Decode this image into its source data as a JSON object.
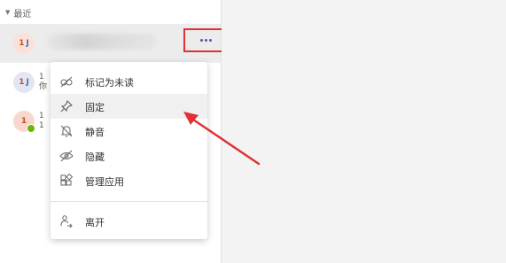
{
  "sidebar": {
    "section_title": "最近",
    "chats": [
      {
        "avatar_left": "1",
        "avatar_right": "J",
        "frag1": "",
        "frag2": "",
        "avatar_bg": "#fbe1d9"
      },
      {
        "avatar_left": "1",
        "avatar_right": "J",
        "frag1": "1",
        "frag2": "你",
        "avatar_bg": "#e2e6f3"
      },
      {
        "avatar_left": "1",
        "avatar_right": "",
        "frag1": "1",
        "frag2": "1",
        "avatar_bg": "#f7d8cd"
      }
    ]
  },
  "context_menu": {
    "items": [
      {
        "label": "标记为未读",
        "icon": "eye-mark-unread-icon"
      },
      {
        "label": "固定",
        "icon": "pin-icon"
      },
      {
        "label": "静音",
        "icon": "bell-off-icon"
      },
      {
        "label": "隐藏",
        "icon": "eye-off-icon"
      },
      {
        "label": "管理应用",
        "icon": "apps-icon"
      },
      {
        "label": "离开",
        "icon": "leave-icon"
      }
    ]
  },
  "colors": {
    "highlight_box": "#e03134",
    "arrow": "#e03134",
    "more_dots": "#4f52b2",
    "presence": "#6bb700"
  }
}
